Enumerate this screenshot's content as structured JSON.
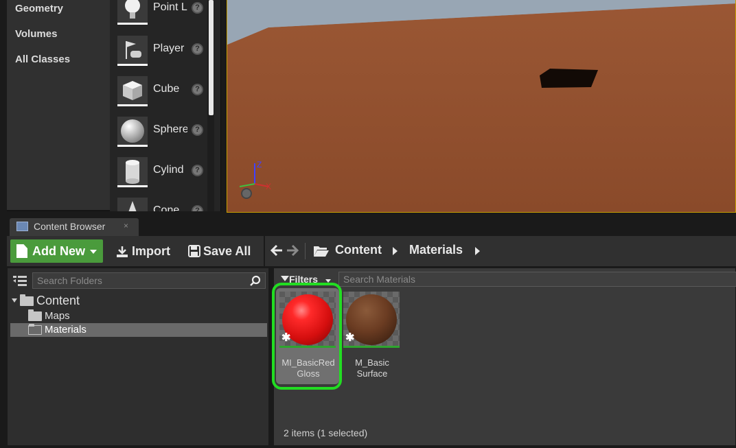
{
  "categories": [
    "Geometry",
    "Volumes",
    "All Classes"
  ],
  "actors": [
    {
      "label": "Point L",
      "icon": "lightbulb-icon"
    },
    {
      "label": "Player",
      "icon": "player-start-icon"
    },
    {
      "label": "Cube",
      "icon": "cube-icon"
    },
    {
      "label": "Sphere",
      "icon": "sphere-icon"
    },
    {
      "label": "Cylind",
      "icon": "cylinder-icon"
    },
    {
      "label": "Cone",
      "icon": "cone-icon"
    }
  ],
  "viewport": {
    "axis_x": "X",
    "axis_z": "Z",
    "floor_color": "#8f4e2c",
    "sky_color": "#9aa7b5"
  },
  "content_browser": {
    "tab_title": "Content Browser",
    "tab_close": "×",
    "toolbar": {
      "add_new": "Add New",
      "import": "Import",
      "save_all": "Save All"
    },
    "breadcrumbs": [
      "Content",
      "Materials"
    ],
    "folders": {
      "search_placeholder": "Search Folders",
      "tree": [
        {
          "label": "Content",
          "level": 0,
          "expanded": true
        },
        {
          "label": "Maps",
          "level": 1
        },
        {
          "label": "Materials",
          "level": 1,
          "selected": true
        }
      ]
    },
    "assets": {
      "filters_label": "Filters",
      "search_placeholder": "Search Materials",
      "items": [
        {
          "name_line1": "MI_BasicRed",
          "name_line2": "Gloss",
          "color": "#e01818",
          "selected": true
        },
        {
          "name_line1": "M_Basic",
          "name_line2": "Surface",
          "color": "#6b3c22",
          "selected": false
        }
      ],
      "status": "2 items (1 selected)"
    }
  },
  "colors": {
    "add_new_green": "#4a9b3c",
    "highlight_ring": "#22dd22",
    "selection_bar": "#2ea52e"
  }
}
